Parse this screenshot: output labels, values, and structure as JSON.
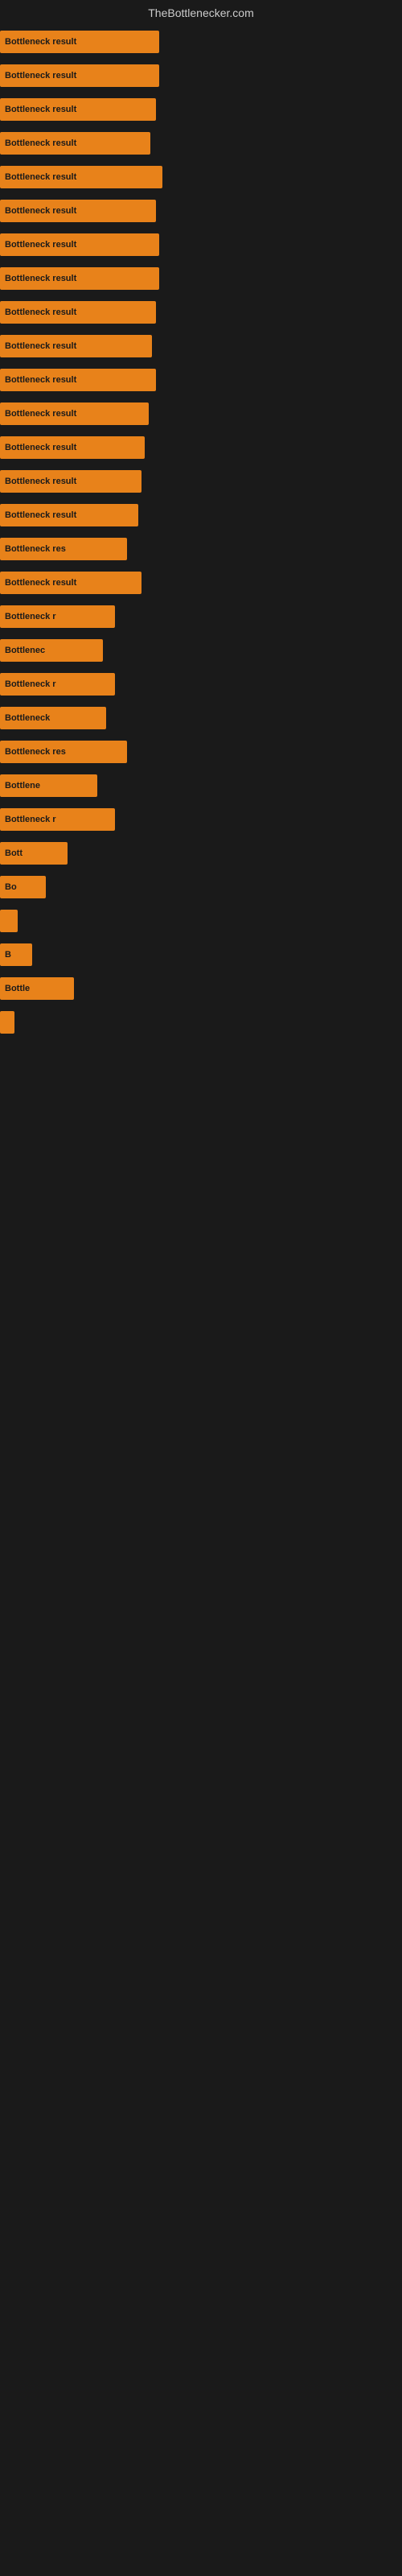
{
  "site": {
    "title": "TheBottlenecker.com"
  },
  "bars": [
    {
      "label": "Bottleneck result",
      "width": 90
    },
    {
      "label": "Bottleneck result",
      "width": 90
    },
    {
      "label": "Bottleneck result",
      "width": 88
    },
    {
      "label": "Bottleneck result",
      "width": 85
    },
    {
      "label": "Bottleneck result",
      "width": 92
    },
    {
      "label": "Bottleneck result",
      "width": 88
    },
    {
      "label": "Bottleneck result",
      "width": 90
    },
    {
      "label": "Bottleneck result",
      "width": 90
    },
    {
      "label": "Bottleneck result",
      "width": 88
    },
    {
      "label": "Bottleneck result",
      "width": 86
    },
    {
      "label": "Bottleneck result",
      "width": 88
    },
    {
      "label": "Bottleneck result",
      "width": 84
    },
    {
      "label": "Bottleneck result",
      "width": 82
    },
    {
      "label": "Bottleneck result",
      "width": 80
    },
    {
      "label": "Bottleneck result",
      "width": 78
    },
    {
      "label": "Bottleneck res",
      "width": 72
    },
    {
      "label": "Bottleneck result",
      "width": 80
    },
    {
      "label": "Bottleneck r",
      "width": 65
    },
    {
      "label": "Bottlenec",
      "width": 58
    },
    {
      "label": "Bottleneck r",
      "width": 65
    },
    {
      "label": "Bottleneck",
      "width": 60
    },
    {
      "label": "Bottleneck res",
      "width": 72
    },
    {
      "label": "Bottlene",
      "width": 55
    },
    {
      "label": "Bottleneck r",
      "width": 65
    },
    {
      "label": "Bott",
      "width": 38
    },
    {
      "label": "Bo",
      "width": 26
    },
    {
      "label": "",
      "width": 10
    },
    {
      "label": "B",
      "width": 18
    },
    {
      "label": "Bottle",
      "width": 42
    },
    {
      "label": "",
      "width": 8
    }
  ],
  "colors": {
    "bar_fill": "#e8821a",
    "bar_text": "#1a1a1a",
    "background": "#1a1a1a",
    "title": "#cccccc"
  }
}
